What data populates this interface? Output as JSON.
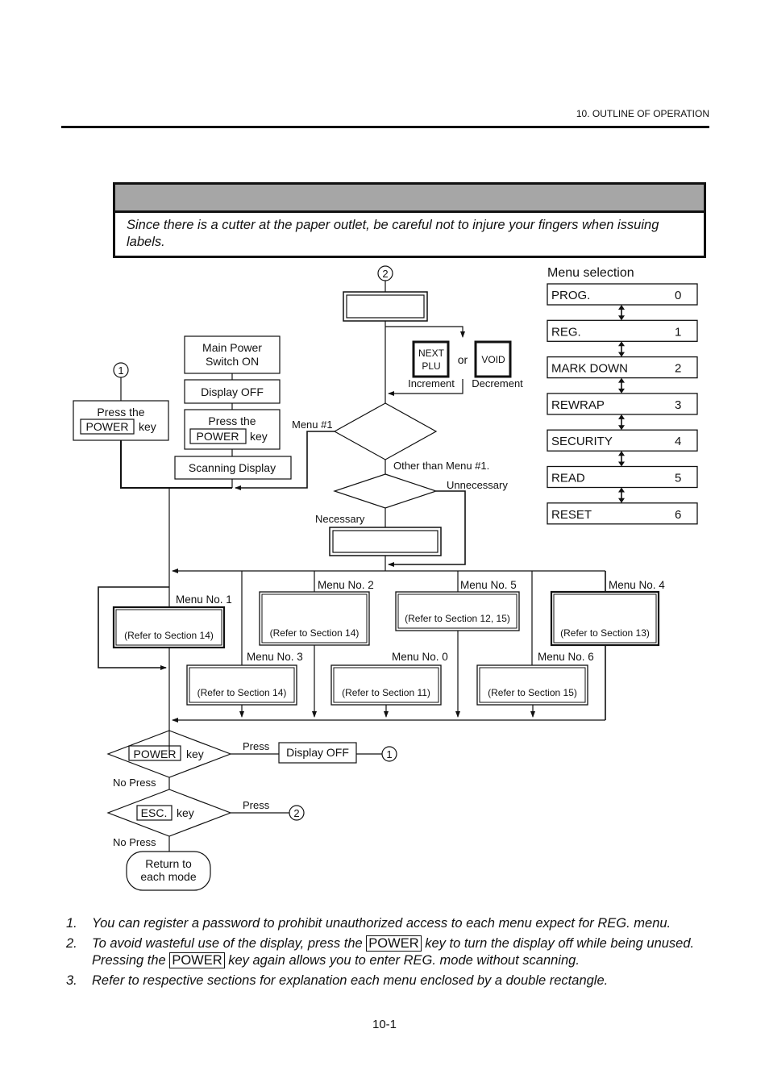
{
  "header": {
    "section": "10. OUTLINE OF OPERATION"
  },
  "caution": {
    "text": "Since there is a cutter at the paper outlet, be careful not to injure your fingers when issuing labels."
  },
  "flow": {
    "connector_1": "1",
    "connector_2": "2",
    "main_power": [
      "Main Power",
      "Switch ON"
    ],
    "display_off": "Display OFF",
    "press_the": "Press the",
    "power_key": "POWER",
    "key": "key",
    "scanning_display": "Scanning Display",
    "next_plu": [
      "NEXT",
      "PLU"
    ],
    "or": "or",
    "void": "VOID",
    "increment": "Increment",
    "decrement": "Decrement",
    "menu1_branch": "Menu #1",
    "other_than_menu1": "Other than Menu #1.",
    "unnecessary": "Unnecessary",
    "necessary": "Necessary",
    "menus": [
      {
        "label": "Menu No. 1",
        "ref": "(Refer to Section 14)"
      },
      {
        "label": "Menu No. 2",
        "ref": "(Refer to Section 14)"
      },
      {
        "label": "Menu No. 5",
        "ref": "(Refer to Section 12, 15)"
      },
      {
        "label": "Menu No. 4",
        "ref": "(Refer to Section 13)"
      },
      {
        "label": "Menu No. 3",
        "ref": "(Refer to Section 14)"
      },
      {
        "label": "Menu No. 0",
        "ref": "(Refer to Section 11)"
      },
      {
        "label": "Menu No. 6",
        "ref": "(Refer to Section 15)"
      }
    ],
    "esc_key": "ESC.",
    "press": "Press",
    "no_press": "No Press",
    "return_to": [
      "Return to",
      "each mode"
    ]
  },
  "menu_selection": {
    "title": "Menu selection",
    "items": [
      {
        "name": "PROG.",
        "num": "0"
      },
      {
        "name": "REG.",
        "num": "1"
      },
      {
        "name": "MARK DOWN",
        "num": "2"
      },
      {
        "name": "REWRAP",
        "num": "3"
      },
      {
        "name": "SECURITY",
        "num": "4"
      },
      {
        "name": "READ",
        "num": "5"
      },
      {
        "name": "RESET",
        "num": "6"
      }
    ]
  },
  "notes": [
    {
      "num": "1.",
      "text": "You can register a password to prohibit unauthorized access to each menu expect for REG. menu."
    },
    {
      "num": "2.",
      "pre": "To avoid wasteful use of the display, press the",
      "key": "POWER",
      "post": "key to turn the display off while being unused.",
      "line2_pre": "Pressing the",
      "line2_key": "POWER",
      "line2_post": "key again allows you to enter REG. mode without scanning."
    },
    {
      "num": "3.",
      "text": "Refer to respective sections for explanation each menu enclosed by a double rectangle."
    }
  ],
  "footer": {
    "page": "10-1"
  }
}
